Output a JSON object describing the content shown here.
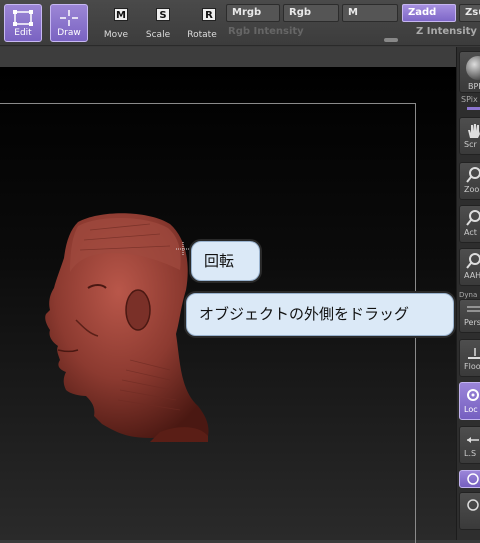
{
  "toolbar": {
    "edit_label": "Edit",
    "draw_label": "Draw",
    "move_label": "Move",
    "move_key": "M",
    "scale_label": "Scale",
    "scale_key": "S",
    "rotate_label": "Rotate",
    "rotate_key": "R"
  },
  "channels": {
    "mrgb": "Mrgb",
    "rgb": "Rgb",
    "m": "M",
    "zadd": "Zadd",
    "zsub": "Zsu"
  },
  "sliders": {
    "rgb_intensity": "Rgb Intensity",
    "z_intensity": "Z Intensity"
  },
  "right_panel": {
    "bpr_label": "BPR",
    "spix_label": "SPix",
    "scroll_label": "Scr",
    "zoom_label": "Zoo",
    "actual_label": "Act",
    "aahalf_label": "AAH",
    "persp_top": "Dyna",
    "persp_label": "Pers",
    "floor_label": "Floo",
    "local_label": "Loc",
    "lsym_label": "L.S"
  },
  "callouts": {
    "rotate": "回転",
    "drag_outside": "オブジェクトの外側をドラッグ"
  },
  "colors": {
    "accent": "#8c75d0",
    "model": "#8a3a30"
  }
}
